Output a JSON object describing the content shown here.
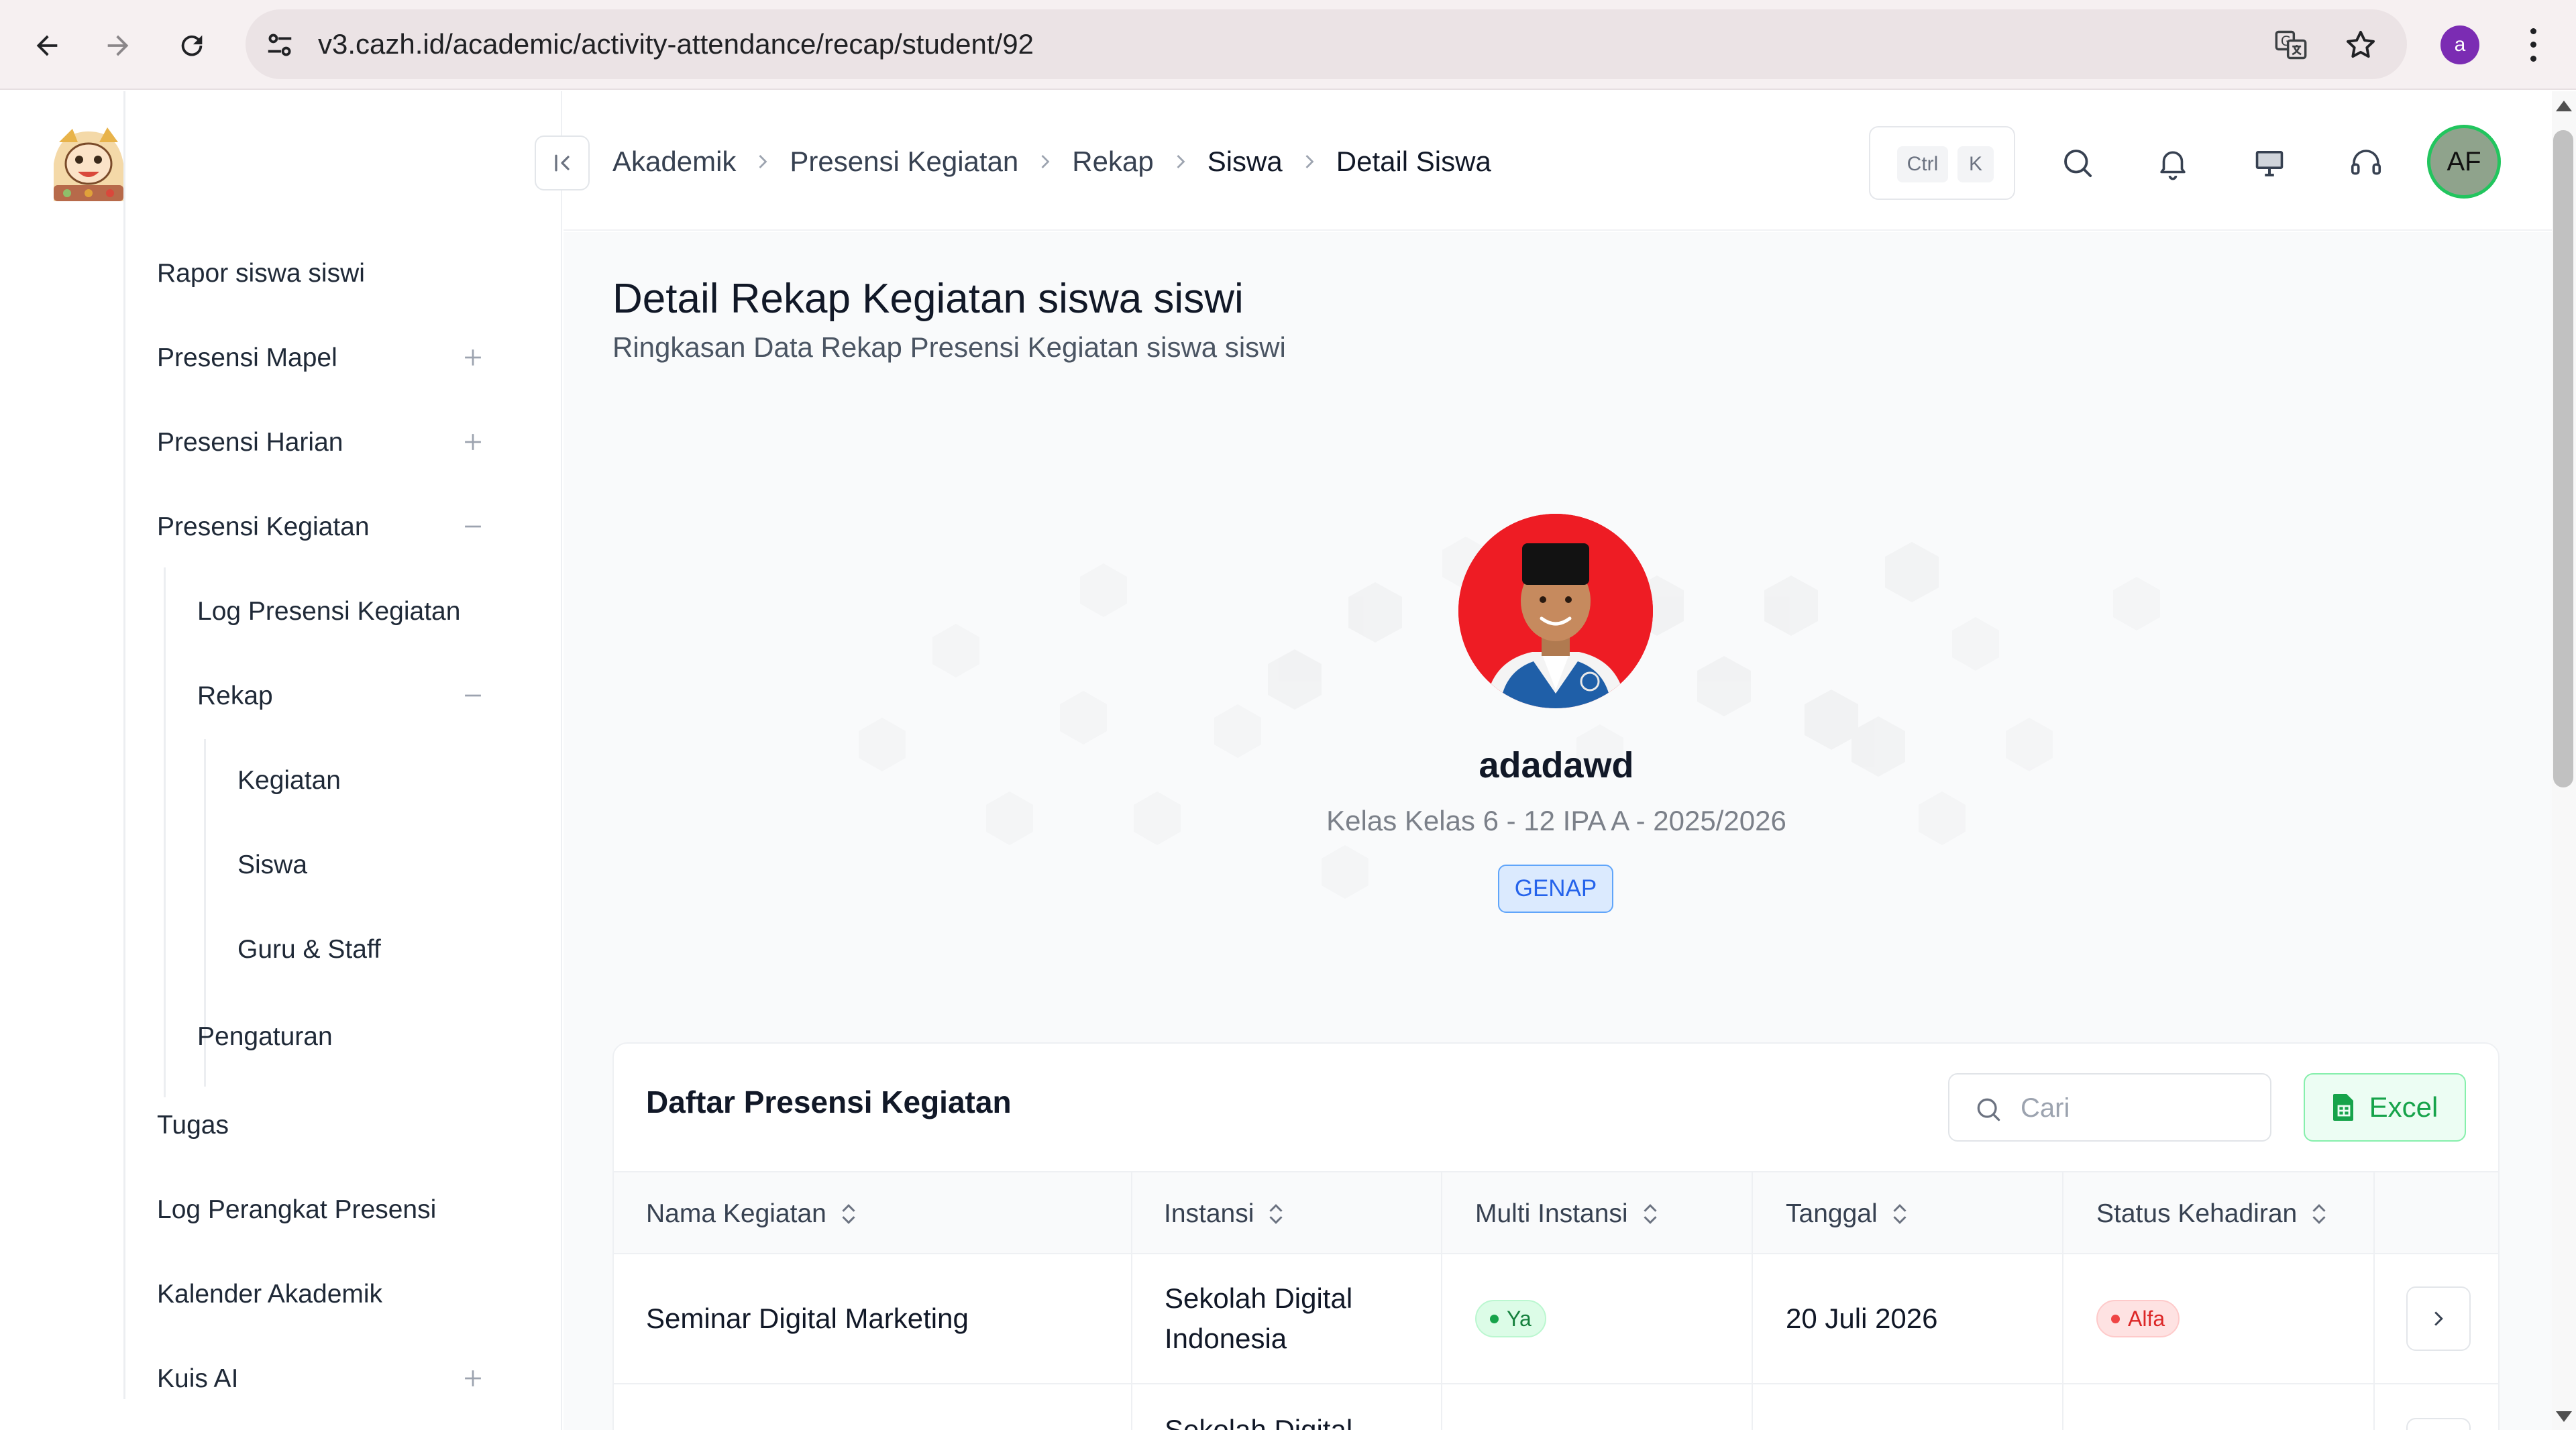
{
  "browser": {
    "url": "v3.cazh.id/academic/activity-attendance/recap/student/92",
    "profile_initial": "a",
    "icons": [
      "back-icon",
      "forward-icon",
      "reload-icon",
      "site-settings-icon",
      "translate-icon",
      "star-icon",
      "kebab-menu-icon"
    ]
  },
  "sidebar": {
    "items": [
      {
        "label": "Rapor siswa siswi",
        "toggle": ""
      },
      {
        "label": "Presensi Mapel",
        "toggle": "plus"
      },
      {
        "label": "Presensi Harian",
        "toggle": "plus"
      },
      {
        "label": "Presensi Kegiatan",
        "toggle": "minus"
      },
      {
        "label": "Log Presensi Kegiatan",
        "toggle": ""
      },
      {
        "label": "Rekap",
        "toggle": "minus"
      },
      {
        "label": "Kegiatan",
        "toggle": ""
      },
      {
        "label": "Siswa",
        "toggle": ""
      },
      {
        "label": "Guru & Staff",
        "toggle": ""
      },
      {
        "label": "Pengaturan",
        "toggle": ""
      },
      {
        "label": "Tugas",
        "toggle": ""
      },
      {
        "label": "Log Perangkat Presensi",
        "toggle": ""
      },
      {
        "label": "Kalender Akademik",
        "toggle": ""
      },
      {
        "label": "Kuis AI",
        "toggle": "plus"
      }
    ]
  },
  "header": {
    "breadcrumb": [
      "Akademik",
      "Presensi Kegiatan",
      "Rekap",
      "Siswa",
      "Detail Siswa"
    ],
    "shortcut_keys": [
      "Ctrl",
      "K"
    ],
    "user_initials": "AF",
    "icons": [
      "search-icon",
      "bell-icon",
      "monitor-icon",
      "headset-icon"
    ]
  },
  "page": {
    "title": "Detail Rekap Kegiatan siswa siswi",
    "subtitle": "Ringkasan Data Rekap Presensi Kegiatan siswa siswi"
  },
  "student": {
    "name": "adadawd",
    "class_info": "Kelas Kelas 6 - 12 IPA A - 2025/2026",
    "semester": "GENAP"
  },
  "attendance_table": {
    "title": "Daftar Presensi Kegiatan",
    "search_placeholder": "Cari",
    "search_value": "",
    "export_label": "Excel",
    "columns": [
      "Nama Kegiatan",
      "Instansi",
      "Multi Instansi",
      "Tanggal",
      "Status Kehadiran"
    ],
    "rows": [
      {
        "name": "Seminar Digital Marketing",
        "instansi_line1": "Sekolah Digital",
        "instansi_line2": "Indonesia",
        "multi_instansi": "Ya",
        "tanggal": "20 Juli 2026",
        "status": "Alfa"
      },
      {
        "name": "",
        "instansi_line1": "Sekolah Digital",
        "instansi_line2": "",
        "multi_instansi": "",
        "tanggal": "",
        "status": ""
      }
    ]
  },
  "colors": {
    "accent_blue": "#2563eb",
    "success_green": "#16a34a",
    "danger_red": "#dc2626",
    "avatar_ring": "#22c55e"
  }
}
